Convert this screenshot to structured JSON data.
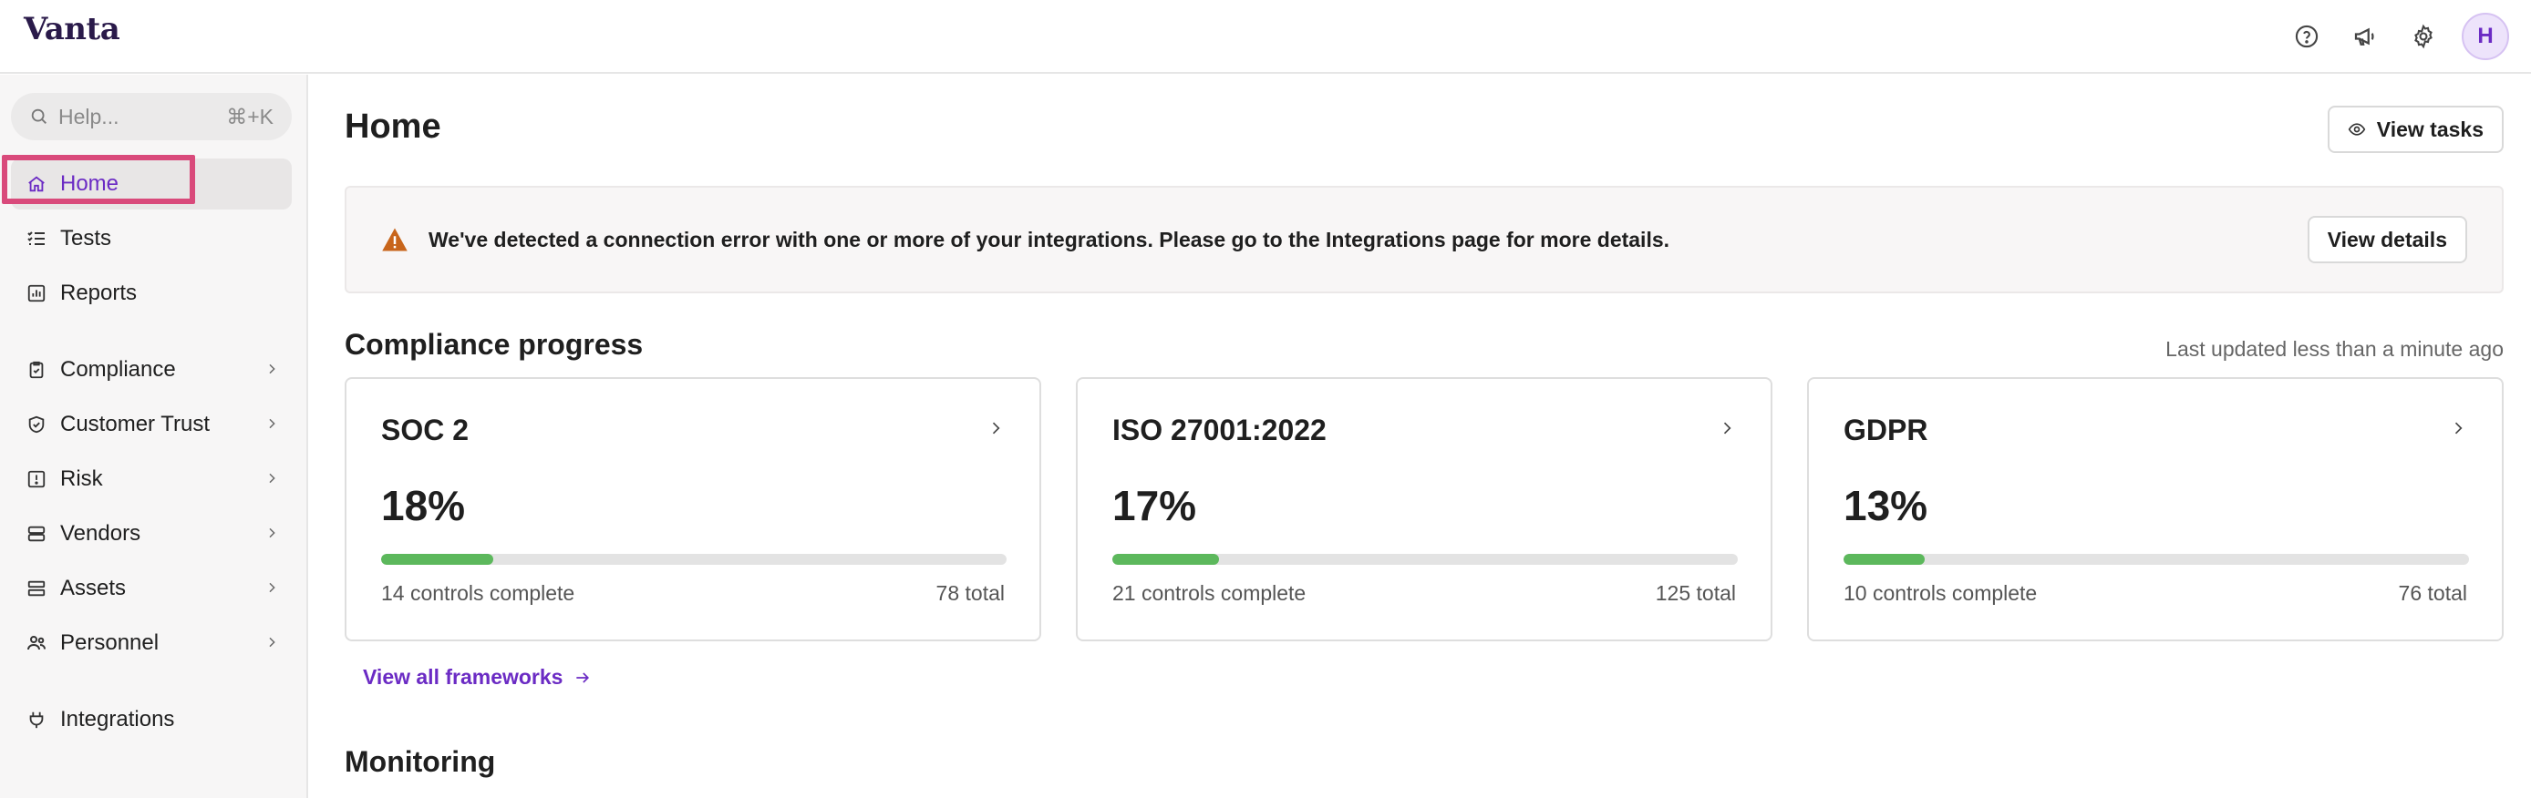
{
  "app": {
    "logo": "Vanta",
    "avatar_initial": "H"
  },
  "topbar": {
    "icons": [
      "help-circle-icon",
      "megaphone-icon",
      "gear-icon"
    ]
  },
  "sidebar": {
    "search_placeholder": "Help...",
    "search_shortcut": "⌘+K",
    "items": [
      {
        "label": "Home",
        "icon": "home-icon",
        "active": true,
        "expandable": false
      },
      {
        "label": "Tests",
        "icon": "checklist-icon",
        "expandable": false
      },
      {
        "label": "Reports",
        "icon": "chart-icon",
        "expandable": false
      },
      {
        "label": "Compliance",
        "icon": "clipboard-check-icon",
        "expandable": true
      },
      {
        "label": "Customer Trust",
        "icon": "shield-check-icon",
        "expandable": true
      },
      {
        "label": "Risk",
        "icon": "alert-square-icon",
        "expandable": true
      },
      {
        "label": "Vendors",
        "icon": "stack-icon",
        "expandable": true
      },
      {
        "label": "Assets",
        "icon": "server-icon",
        "expandable": true
      },
      {
        "label": "Personnel",
        "icon": "people-icon",
        "expandable": true
      },
      {
        "label": "Integrations",
        "icon": "plug-icon",
        "expandable": false
      }
    ]
  },
  "main": {
    "title": "Home",
    "view_tasks_label": "View tasks",
    "alert": {
      "message": "We've detected a connection error with one or more of your integrations. Please go to the Integrations page for more details.",
      "button_label": "View details",
      "color": "#c8651b"
    },
    "compliance": {
      "title": "Compliance progress",
      "updated": "Last updated less than a minute ago",
      "frameworks": [
        {
          "name": "SOC 2",
          "percent_label": "18%",
          "progress": 0.18,
          "complete": "14 controls complete",
          "total": "78 total"
        },
        {
          "name": "ISO 27001:2022",
          "percent_label": "17%",
          "progress": 0.17,
          "complete": "21 controls complete",
          "total": "125 total"
        },
        {
          "name": "GDPR",
          "percent_label": "13%",
          "progress": 0.13,
          "complete": "10 controls complete",
          "total": "76 total"
        }
      ],
      "view_all_label": "View all frameworks"
    },
    "monitoring_title": "Monitoring"
  },
  "colors": {
    "accent": "#6b2bc4",
    "progress": "#5cb85c",
    "focus": "#d94a7b"
  }
}
